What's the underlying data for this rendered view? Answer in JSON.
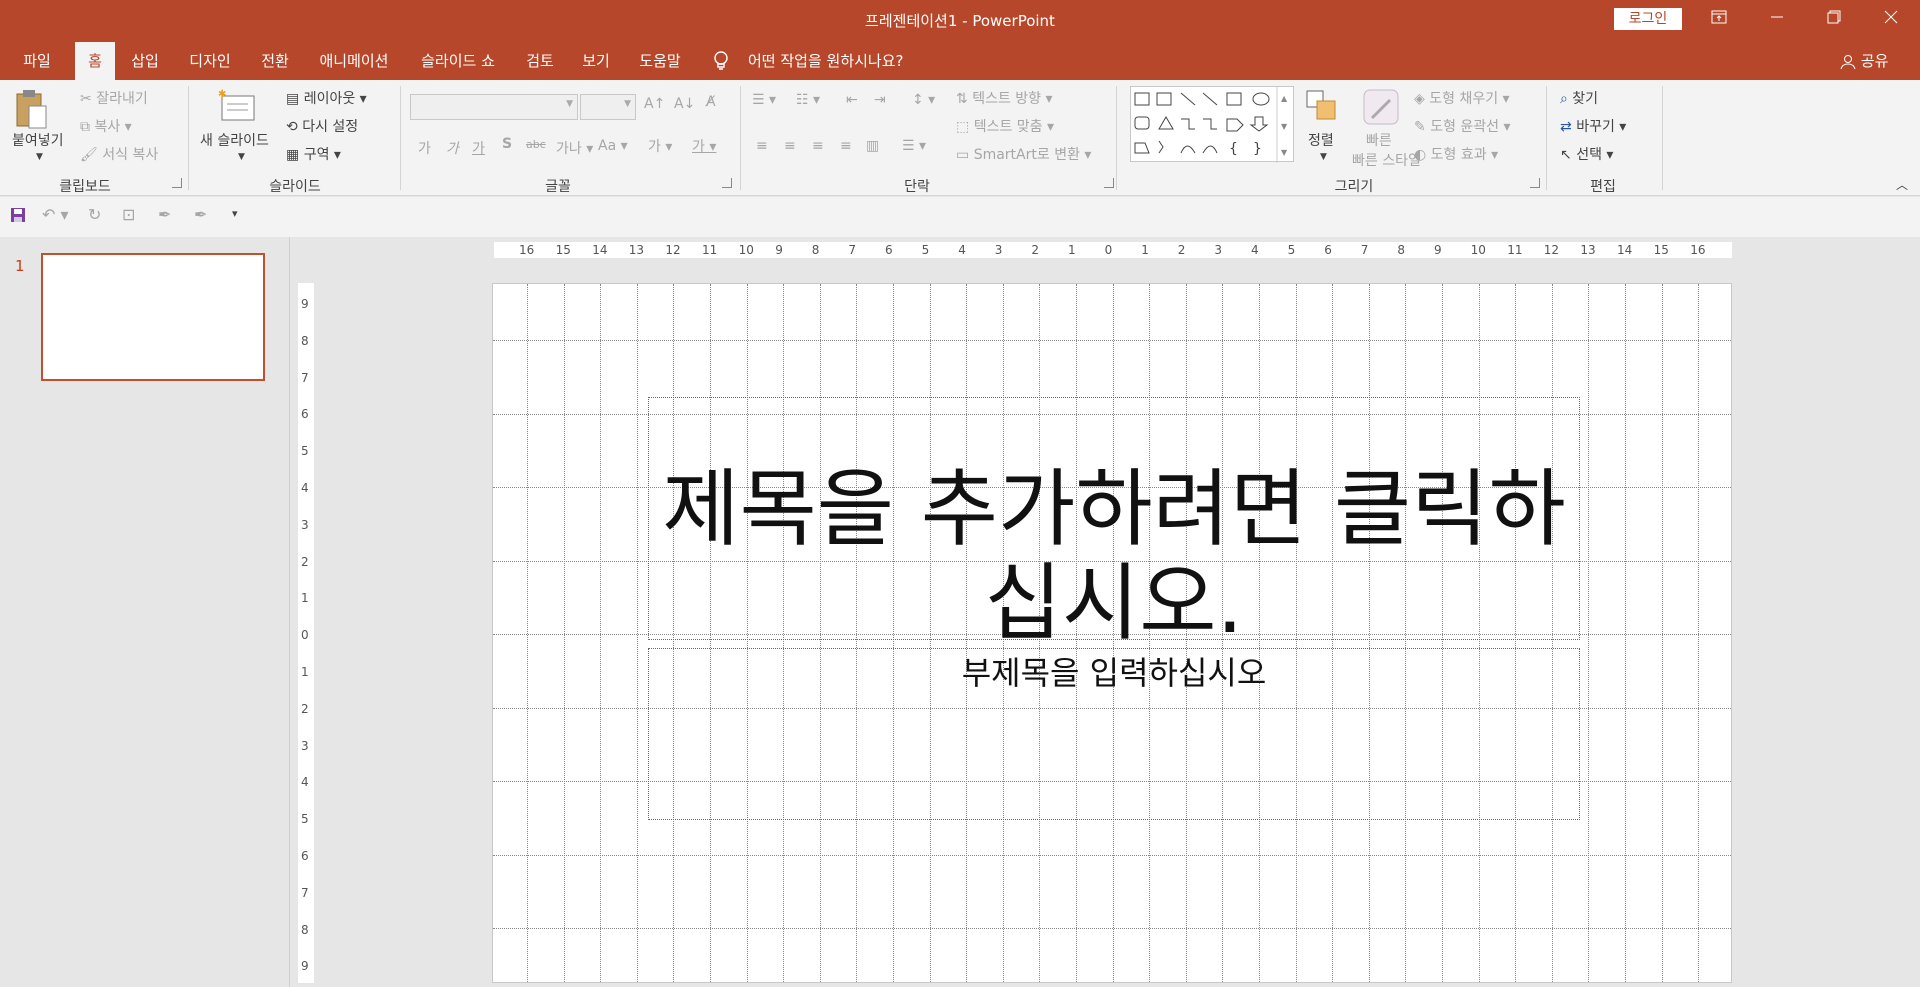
{
  "window": {
    "title": "프레젠테이션1  -  PowerPoint",
    "signin": "로그인"
  },
  "tabs": [
    {
      "label": "파일"
    },
    {
      "label": "홈"
    },
    {
      "label": "삽입"
    },
    {
      "label": "디자인"
    },
    {
      "label": "전환"
    },
    {
      "label": "애니메이션"
    },
    {
      "label": "슬라이드 쇼"
    },
    {
      "label": "검토"
    },
    {
      "label": "보기"
    },
    {
      "label": "도움말"
    }
  ],
  "tell_me": "어떤 작업을 원하시나요?",
  "share": "공유",
  "ribbon": {
    "clipboard": {
      "label": "클립보드",
      "paste": "붙여넣기",
      "cut": "잘라내기",
      "copy": "복사",
      "format_painter": "서식 복사"
    },
    "slides": {
      "label": "슬라이드",
      "new_slide": "새 슬라이드",
      "layout": "레이아웃",
      "reset": "다시 설정",
      "section": "구역"
    },
    "font": {
      "label": "글꼴",
      "bold": "가",
      "italic": "가",
      "underline": "가",
      "shadow": "S",
      "strike": "abc",
      "spacing": "가나",
      "case": "Aa",
      "highlight": "가",
      "color": "가"
    },
    "paragraph": {
      "label": "단락",
      "text_direction": "텍스트 방향",
      "align_text": "텍스트 맞춤",
      "smartart": "SmartArt로 변환"
    },
    "drawing": {
      "label": "그리기",
      "arrange": "정렬",
      "quick_styles": "빠른 스타일",
      "fill": "도형 채우기",
      "outline": "도형 윤곽선",
      "effects": "도형 효과"
    },
    "editing": {
      "label": "편집",
      "find": "찾기",
      "replace": "바꾸기",
      "select": "선택"
    }
  },
  "thumbnail": {
    "number": "1"
  },
  "hruler_ticks": [
    "16",
    "15",
    "14",
    "13",
    "12",
    "11",
    "10",
    "9",
    "8",
    "7",
    "6",
    "5",
    "4",
    "3",
    "2",
    "1",
    "0",
    "1",
    "2",
    "3",
    "4",
    "5",
    "6",
    "7",
    "8",
    "9",
    "10",
    "11",
    "12",
    "13",
    "14",
    "15",
    "16"
  ],
  "vruler_ticks": [
    "9",
    "8",
    "7",
    "6",
    "5",
    "4",
    "3",
    "2",
    "1",
    "0",
    "1",
    "2",
    "3",
    "4",
    "5",
    "6",
    "7",
    "8",
    "9"
  ],
  "slide": {
    "title_line1": "제목을 추가하려면 클릭하",
    "title_line2": "십시오.",
    "subtitle": "부제목을 입력하십시오"
  }
}
